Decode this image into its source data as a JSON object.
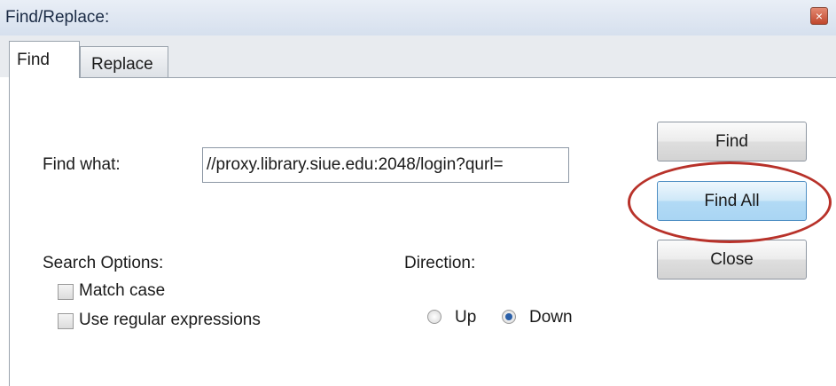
{
  "window": {
    "title": "Find/Replace:",
    "close_glyph": "×"
  },
  "tabs": [
    {
      "label": "Find",
      "active": true
    },
    {
      "label": "Replace",
      "active": false
    }
  ],
  "find": {
    "label": "Find what:",
    "value": "//proxy.library.siue.edu:2048/login?qurl="
  },
  "search_options": {
    "heading": "Search Options:",
    "match_case": {
      "label": "Match case",
      "checked": false
    },
    "regex": {
      "label": "Use regular expressions",
      "checked": false
    }
  },
  "direction": {
    "heading": "Direction:",
    "options": [
      {
        "label": "Up",
        "selected": false
      },
      {
        "label": "Down",
        "selected": true
      }
    ]
  },
  "buttons": {
    "find": "Find",
    "find_all": "Find All",
    "close": "Close"
  },
  "colors": {
    "highlight_annotation": "#b8322a",
    "find_all_accent": "#a9d5f3"
  }
}
